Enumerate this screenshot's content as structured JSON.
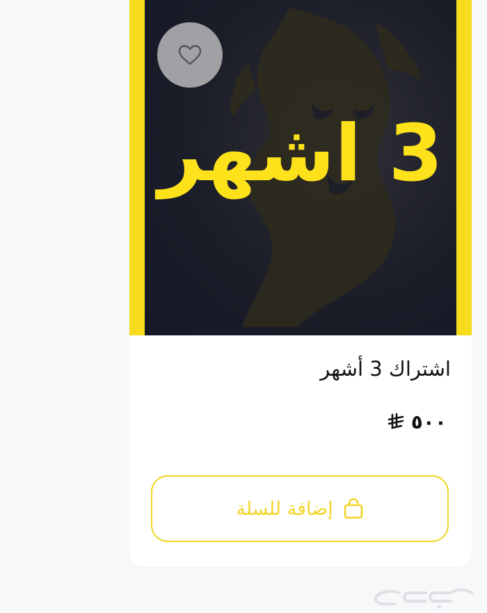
{
  "product_card": {
    "image_text": "3 اشهر",
    "name": "اشتراك 3 أشهر",
    "price": "٥٠٠",
    "add_to_cart_label": "إضافة للسلة"
  },
  "watermark": {
    "text": "حراج"
  },
  "icons": {
    "favorite": "heart-icon",
    "currency": "riyal-icon",
    "cart": "shopping-bag-icon"
  },
  "colors": {
    "accent_yellow": "#f6dc1c",
    "button_yellow": "#f2d427",
    "image_dark": "#1b1d28",
    "page_bg": "#f7f8fa",
    "card_bg": "#ffffff",
    "text": "#111111"
  }
}
